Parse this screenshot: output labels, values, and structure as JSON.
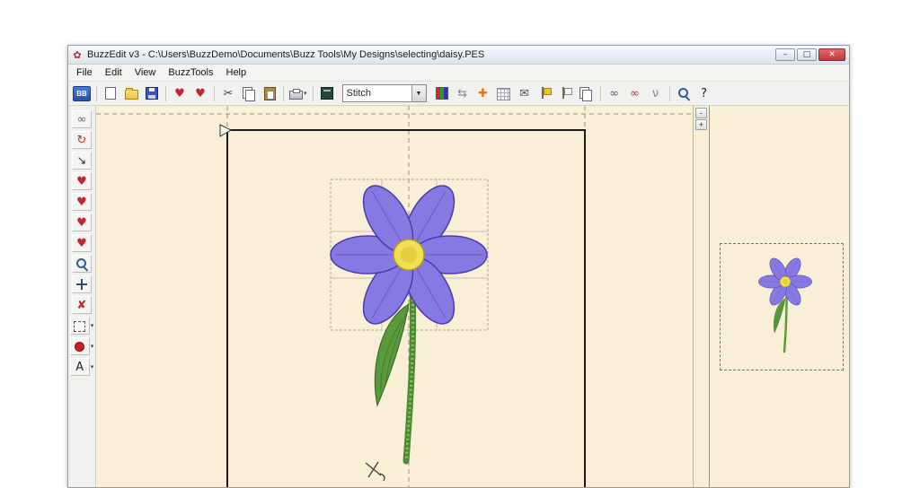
{
  "window": {
    "title": "BuzzEdit v3 - C:\\Users\\BuzzDemo\\Documents\\Buzz Tools\\My Designs\\selecting\\daisy.PES",
    "icon_glyph": "✿",
    "controls": {
      "minimize": "–",
      "maximize": "□",
      "close": "✕"
    }
  },
  "menu": {
    "items": [
      {
        "label": "File"
      },
      {
        "label": "Edit"
      },
      {
        "label": "View"
      },
      {
        "label": "BuzzTools"
      },
      {
        "label": "Help"
      }
    ]
  },
  "ui": {
    "dropdown_arrow": "▾",
    "combo_arrow": "▼"
  },
  "toolbar": {
    "stitch_selector": {
      "value": "Stitch"
    },
    "items": [
      {
        "name": "buzzedit-logo-button",
        "kind": "logo",
        "text": "BB"
      },
      {
        "kind": "sep"
      },
      {
        "name": "new-button",
        "kind": "css",
        "icon": "page"
      },
      {
        "name": "open-button",
        "kind": "css",
        "icon": "folder"
      },
      {
        "name": "save-button",
        "kind": "css",
        "icon": "floppy"
      },
      {
        "kind": "sep"
      },
      {
        "name": "design-properties-button",
        "kind": "glyph",
        "glyph": "♥",
        "color": "#C22531"
      },
      {
        "name": "design-check-button",
        "kind": "glyph",
        "glyph": "♥",
        "color": "#C22531"
      },
      {
        "kind": "sep"
      },
      {
        "name": "cut-button",
        "kind": "glyph",
        "glyph": "✂",
        "color": "#444444"
      },
      {
        "name": "copy-button",
        "kind": "css",
        "icon": "copy"
      },
      {
        "name": "paste-button",
        "kind": "css",
        "icon": "paste"
      },
      {
        "kind": "sep"
      },
      {
        "name": "print-button",
        "kind": "css",
        "icon": "printer",
        "dropdown": true
      },
      {
        "kind": "sep"
      },
      {
        "name": "hoop-setup-button",
        "kind": "css",
        "icon": "ruler"
      },
      {
        "kind": "combo"
      },
      {
        "name": "thread-colors-button",
        "kind": "css",
        "icon": "colorbar"
      },
      {
        "name": "refresh-button",
        "kind": "glyph",
        "glyph": "⇆",
        "color": "#888888"
      },
      {
        "name": "center-design-button",
        "kind": "glyph",
        "glyph": "✚",
        "color": "#E07818"
      },
      {
        "name": "grid-settings-button",
        "kind": "css",
        "icon": "grid"
      },
      {
        "name": "send-design-button",
        "kind": "glyph",
        "glyph": "✉",
        "color": "#555555"
      },
      {
        "name": "flag-marker-button",
        "kind": "css",
        "icon": "flag"
      },
      {
        "name": "flag-clear-button",
        "kind": "css",
        "icon": "flagw"
      },
      {
        "name": "copies-button",
        "kind": "css",
        "icon": "copy"
      },
      {
        "kind": "sep"
      },
      {
        "name": "stitch-simulate-button",
        "kind": "glyph",
        "glyph": "∞",
        "color": "#556"
      },
      {
        "name": "realistic-view-button",
        "kind": "glyph",
        "glyph": "∞",
        "color": "#A33"
      },
      {
        "name": "fabric-view-button",
        "kind": "glyph",
        "glyph": "ν",
        "color": "#888888"
      },
      {
        "kind": "sep"
      },
      {
        "name": "zoom-button",
        "kind": "css",
        "icon": "mag"
      },
      {
        "name": "context-help-button",
        "kind": "glyph",
        "glyph": "?",
        "color": "#222222"
      }
    ]
  },
  "palette": {
    "items": [
      {
        "name": "view-settings-tool",
        "kind": "glyph",
        "glyph": "∞",
        "color": "#666666"
      },
      {
        "name": "rotate-design-tool",
        "kind": "glyph",
        "glyph": "↻",
        "color": "#C22531"
      },
      {
        "name": "stitch-order-tool",
        "kind": "glyph",
        "glyph": "↘",
        "color": "#333333"
      },
      {
        "name": "edit-design-tool",
        "kind": "glyph",
        "glyph": "♥",
        "color": "#C22531"
      },
      {
        "name": "adjust-design-tool",
        "kind": "glyph",
        "glyph": "♥",
        "color": "#C22531"
      },
      {
        "name": "split-design-tool",
        "kind": "glyph",
        "glyph": "♥",
        "color": "#C22531"
      },
      {
        "name": "stitch-design-tool",
        "kind": "glyph",
        "glyph": "♥",
        "color": "#C22531"
      },
      {
        "name": "zoom-in-tool",
        "kind": "css",
        "icon": "mag"
      },
      {
        "name": "pan-tool",
        "kind": "css",
        "icon": "move"
      },
      {
        "name": "delete-stitch-tool",
        "kind": "glyph",
        "glyph": "✘",
        "color": "#C22531"
      },
      {
        "name": "select-tool",
        "kind": "css",
        "icon": "lasso",
        "dropdown": true
      },
      {
        "name": "color-dot-tool",
        "kind": "css",
        "icon": "dot",
        "dropdown": true
      },
      {
        "name": "text-tool",
        "kind": "glyph",
        "glyph": "A",
        "color": "#222222",
        "dropdown": true
      }
    ]
  },
  "scrollbar": {
    "minus": "-",
    "plus": "+"
  },
  "colors": {
    "canvas_bg": "#F9EED6",
    "petal": "#8679E2",
    "petal_dark": "#4A3AAE",
    "flower_center": "#F0DF4E",
    "center_dark": "#B49B1E",
    "stem": "#4E8A33",
    "stem_light": "#8CC06A",
    "leaf": "#5B9A3C",
    "leaf_dark": "#2F6420",
    "hoop": "#1A1A1A"
  }
}
